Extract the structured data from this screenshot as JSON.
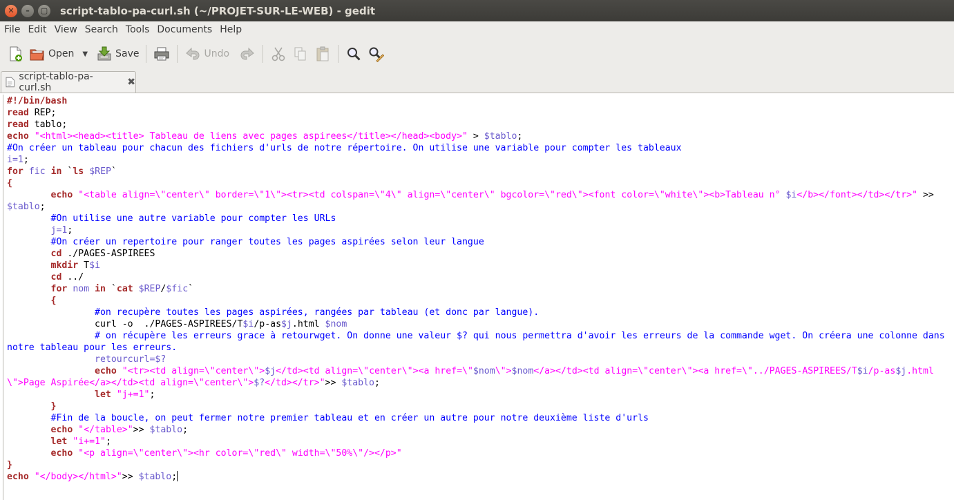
{
  "window": {
    "title": "script-tablo-pa-curl.sh (~/PROJET-SUR-LE-WEB) - gedit",
    "close_glyph": "✕",
    "min_glyph": "–",
    "max_glyph": "▢"
  },
  "menu": {
    "items": [
      "File",
      "Edit",
      "View",
      "Search",
      "Tools",
      "Documents",
      "Help"
    ]
  },
  "toolbar": {
    "open_label": "Open",
    "open_arrow": "▼",
    "save_label": "Save",
    "undo_label": "Undo"
  },
  "tab": {
    "label": "script-tablo-pa-curl.sh",
    "close_glyph": "✖"
  },
  "code": {
    "l1_a": "#!/bin/bash",
    "l2_a": "read",
    "l2_b": " REP;",
    "l3_a": "read",
    "l3_b": " tablo;",
    "l4_a": "echo",
    "l4_b": " ",
    "l4_c": "\"<html><head><title> Tableau de liens avec pages aspirees</title></head><body>\"",
    "l4_d": " > ",
    "l4_e": "$tablo",
    "l4_f": ";",
    "l5_a": "#On créer un tableau pour chacun des fichiers d'urls de notre répertoire. On utilise une variable pour compter les tableaux",
    "l6_a": "i=1",
    "l6_b": ";",
    "l7_a": "for",
    "l7_b": " ",
    "l7_c": "fic",
    "l7_d": " ",
    "l7_e": "in",
    "l7_f": " `",
    "l7_g": "ls",
    "l7_h": " ",
    "l7_i": "$REP",
    "l7_j": "`",
    "l8_a": "{",
    "l9_a": "        ",
    "l9_b": "echo",
    "l9_c": " ",
    "l9_d": "\"<table align=\\\"center\\\" border=\\\"1\\\"><tr><td colspan=\\\"4\\\" align=\\\"center\\\" bgcolor=\\\"red\\\"><font color=\\\"white\\\"><b>Tableau n° ",
    "l9_e": "$i",
    "l9_f": "</b></font></td></tr>\"",
    "l9_g": " >>",
    "l10_a": "$tablo",
    "l10_b": ";",
    "l11_a": "        ",
    "l11_b": "#On utilise une autre variable pour compter les URLs",
    "l12_a": "        ",
    "l12_b": "j=1",
    "l12_c": ";",
    "l13_a": "        ",
    "l13_b": "#On créer un repertoire pour ranger toutes les pages aspirées selon leur langue",
    "l14_a": "        ",
    "l14_b": "cd",
    "l14_c": " ./PAGES-ASPIREES",
    "l15_a": "        ",
    "l15_b": "mkdir",
    "l15_c": " T",
    "l15_d": "$i",
    "l16_a": "        ",
    "l16_b": "cd",
    "l16_c": " ../",
    "l17_a": "        ",
    "l17_b": "for",
    "l17_c": " ",
    "l17_d": "nom",
    "l17_e": " ",
    "l17_f": "in",
    "l17_g": " `",
    "l17_h": "cat",
    "l17_i": " ",
    "l17_j": "$REP",
    "l17_k": "/",
    "l17_l": "$fic",
    "l17_m": "`",
    "l18_a": "        ",
    "l18_b": "{",
    "l19_a": "                ",
    "l19_b": "#on recupère toutes les pages aspirées, rangées par tableau (et donc par langue).",
    "l20_a": "                ",
    "l20_b": "curl -o  ./PAGES-ASPIREES/T",
    "l20_c": "$i",
    "l20_d": "/p-as",
    "l20_e": "$j",
    "l20_f": ".html ",
    "l20_g": "$nom",
    "l21_a": "                ",
    "l21_b": "# on récupère les erreurs grace à retourwget. On donne une valeur $? qui nous permettra d'avoir les erreurs de la commande wget. On créera une colonne dans",
    "l22_a": "notre tableau pour les erreurs.",
    "l23_a": "                ",
    "l23_b": "retourcurl=$?",
    "l24_a": "                ",
    "l24_b": "echo",
    "l24_c": " ",
    "l24_d": "\"<tr><td align=\\\"center\\\">",
    "l24_e": "$j",
    "l24_f": "</td><td align=\\\"center\\\"><a href=\\\"",
    "l24_g": "$nom",
    "l24_h": "\\\">",
    "l24_i": "$nom",
    "l24_j": "</a></td><td align=\\\"center\\\"><a href=\\\"../PAGES-ASPIREES/T",
    "l24_k": "$i",
    "l24_l": "/p-as",
    "l24_m": "$j",
    "l24_n": ".html",
    "l25_a": "\\\">Page Aspirée</a></td><td align=\\\"center\\\">",
    "l25_b": "$?",
    "l25_c": "</td></tr>\"",
    "l25_d": ">> ",
    "l25_e": "$tablo",
    "l25_f": ";",
    "l26_a": "                ",
    "l26_b": "let",
    "l26_c": " ",
    "l26_d": "\"j+=1\"",
    "l26_e": ";",
    "l27_a": "        ",
    "l27_b": "}",
    "l28_a": "        ",
    "l28_b": "#Fin de la boucle, on peut fermer notre premier tableau et en créer un autre pour notre deuxième liste d'urls",
    "l29_a": "        ",
    "l29_b": "echo",
    "l29_c": " ",
    "l29_d": "\"</table>\"",
    "l29_e": ">> ",
    "l29_f": "$tablo",
    "l29_g": ";",
    "l30_a": "        ",
    "l30_b": "let",
    "l30_c": " ",
    "l30_d": "\"i+=1\"",
    "l30_e": ";",
    "l31_a": "        ",
    "l31_b": "echo",
    "l31_c": " ",
    "l31_d": "\"<p align=\\\"center\\\"><hr color=\\\"red\\\" width=\\\"50%\\\"/></p>\"",
    "l32_a": "}",
    "l33_a": "echo",
    "l33_b": " ",
    "l33_c": "\"</body></html>\"",
    "l33_d": ">> ",
    "l33_e": "$tablo",
    "l33_f": ";"
  }
}
